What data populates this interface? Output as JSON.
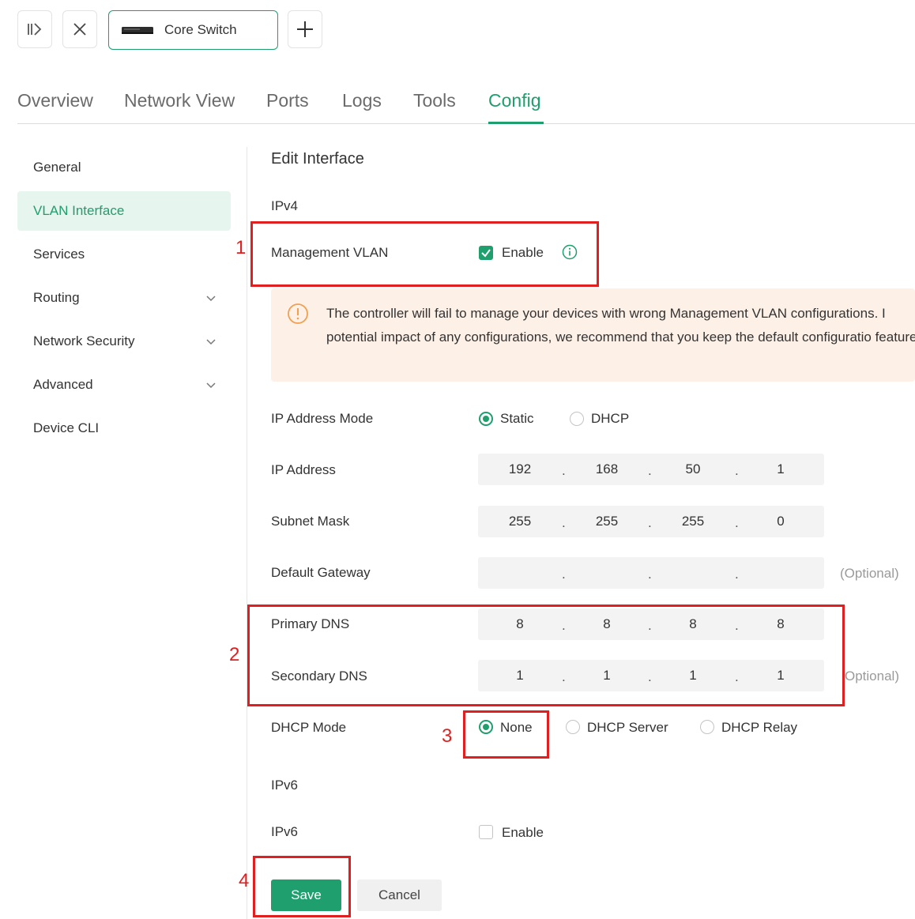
{
  "topbar": {
    "device_tab_label": "Core Switch"
  },
  "tabs": [
    {
      "label": "Overview"
    },
    {
      "label": "Network View"
    },
    {
      "label": "Ports"
    },
    {
      "label": "Logs"
    },
    {
      "label": "Tools"
    },
    {
      "label": "Config",
      "active": true
    }
  ],
  "sidebar": {
    "items": [
      {
        "label": "General"
      },
      {
        "label": "VLAN Interface",
        "active": true
      },
      {
        "label": "Services"
      },
      {
        "label": "Routing",
        "expandable": true
      },
      {
        "label": "Network Security",
        "expandable": true
      },
      {
        "label": "Advanced",
        "expandable": true
      },
      {
        "label": "Device CLI"
      }
    ]
  },
  "form": {
    "title": "Edit Interface",
    "ipv4_label": "IPv4",
    "mgmt_vlan": {
      "label": "Management VLAN",
      "checkbox_label": "Enable",
      "checked": true
    },
    "warning": "The controller will fail to manage your devices with wrong Management VLAN configurations. I potential impact of any configurations, we recommend that you keep the default configuratio feature.",
    "ip_mode": {
      "label": "IP Address Mode",
      "options": [
        "Static",
        "DHCP"
      ],
      "selected": "Static"
    },
    "ip_address": {
      "label": "IP Address",
      "octets": [
        "192",
        "168",
        "50",
        "1"
      ]
    },
    "subnet_mask": {
      "label": "Subnet Mask",
      "octets": [
        "255",
        "255",
        "255",
        "0"
      ]
    },
    "default_gateway": {
      "label": "Default Gateway",
      "octets": [
        "",
        "",
        "",
        ""
      ],
      "note": "(Optional)"
    },
    "primary_dns": {
      "label": "Primary DNS",
      "octets": [
        "8",
        "8",
        "8",
        "8"
      ]
    },
    "secondary_dns": {
      "label": "Secondary DNS",
      "octets": [
        "1",
        "1",
        "1",
        "1"
      ],
      "note": "Optional)"
    },
    "dhcp_mode": {
      "label": "DHCP Mode",
      "options": [
        "None",
        "DHCP Server",
        "DHCP Relay"
      ],
      "selected": "None"
    },
    "ipv6_section": "IPv6",
    "ipv6": {
      "label": "IPv6",
      "checkbox_label": "Enable",
      "checked": false
    },
    "save_label": "Save",
    "cancel_label": "Cancel"
  },
  "annotations": [
    "1",
    "2",
    "3",
    "4"
  ],
  "colors": {
    "accent": "#1f9e6e",
    "warning_bg": "#fdf0e7",
    "warning_icon": "#f0a050",
    "annotation": "#e02020"
  }
}
